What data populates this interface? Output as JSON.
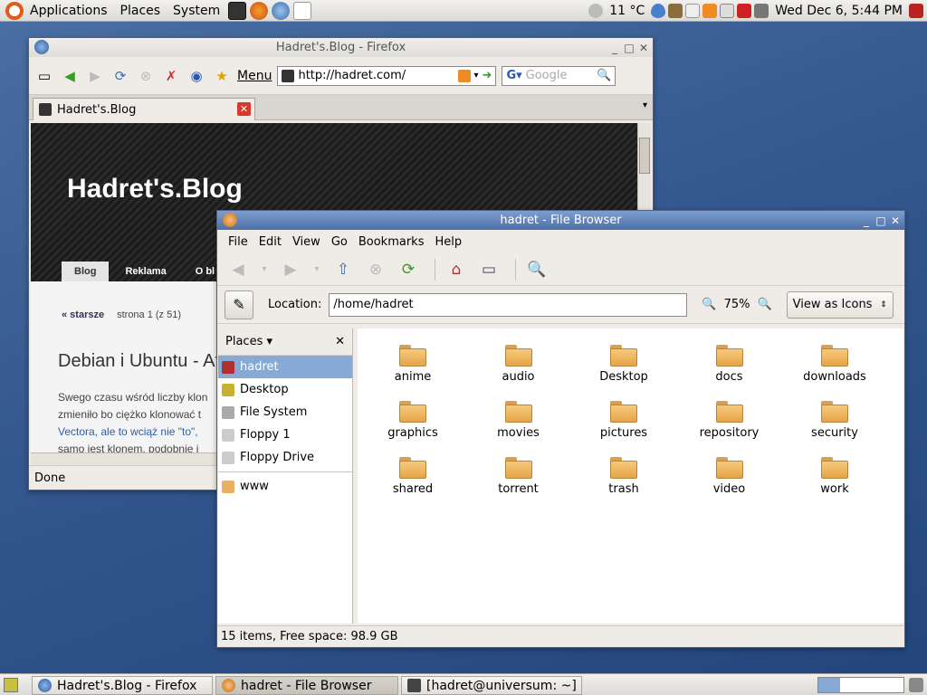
{
  "top_panel": {
    "menus": [
      "Applications",
      "Places",
      "System"
    ],
    "weather": "11 °C",
    "clock": "Wed Dec  6,  5:44 PM"
  },
  "firefox": {
    "title": "Hadret's.Blog - Firefox",
    "menu_label": "Menu",
    "url": "http://hadret.com/",
    "search_placeholder": "Google",
    "tab_label": "Hadret's.Blog",
    "blog_title": "Hadret's.Blog",
    "nav": [
      "Blog",
      "Reklama",
      "O bl"
    ],
    "pager": {
      "prev": "« starsze",
      "page": "strona 1 (z 51)"
    },
    "post_title": "Debian i Ubuntu - At",
    "post_lines": [
      "Swego czasu wśród liczby klon",
      "zmieniło bo ciężko klonować t",
      "Vectora, ale to wciąż nie \"to\",",
      "samo jest klonem, podobnie i"
    ],
    "status": "Done"
  },
  "file_browser": {
    "title": "hadret - File Browser",
    "menus": [
      "File",
      "Edit",
      "View",
      "Go",
      "Bookmarks",
      "Help"
    ],
    "location_label": "Location:",
    "location": "/home/hadret",
    "zoom": "75%",
    "view_mode": "View as Icons",
    "places_label": "Places",
    "places": [
      "hadret",
      "Desktop",
      "File System",
      "Floppy 1",
      "Floppy Drive"
    ],
    "bookmarks": [
      "www"
    ],
    "folders": [
      "anime",
      "audio",
      "Desktop",
      "docs",
      "downloads",
      "graphics",
      "movies",
      "pictures",
      "repository",
      "security",
      "shared",
      "torrent",
      "trash",
      "video",
      "work"
    ],
    "status": "15 items, Free space: 98.9 GB"
  },
  "taskbar": {
    "items": [
      "Hadret's.Blog - Firefox",
      "hadret - File Browser",
      "[hadret@universum: ~]"
    ]
  }
}
